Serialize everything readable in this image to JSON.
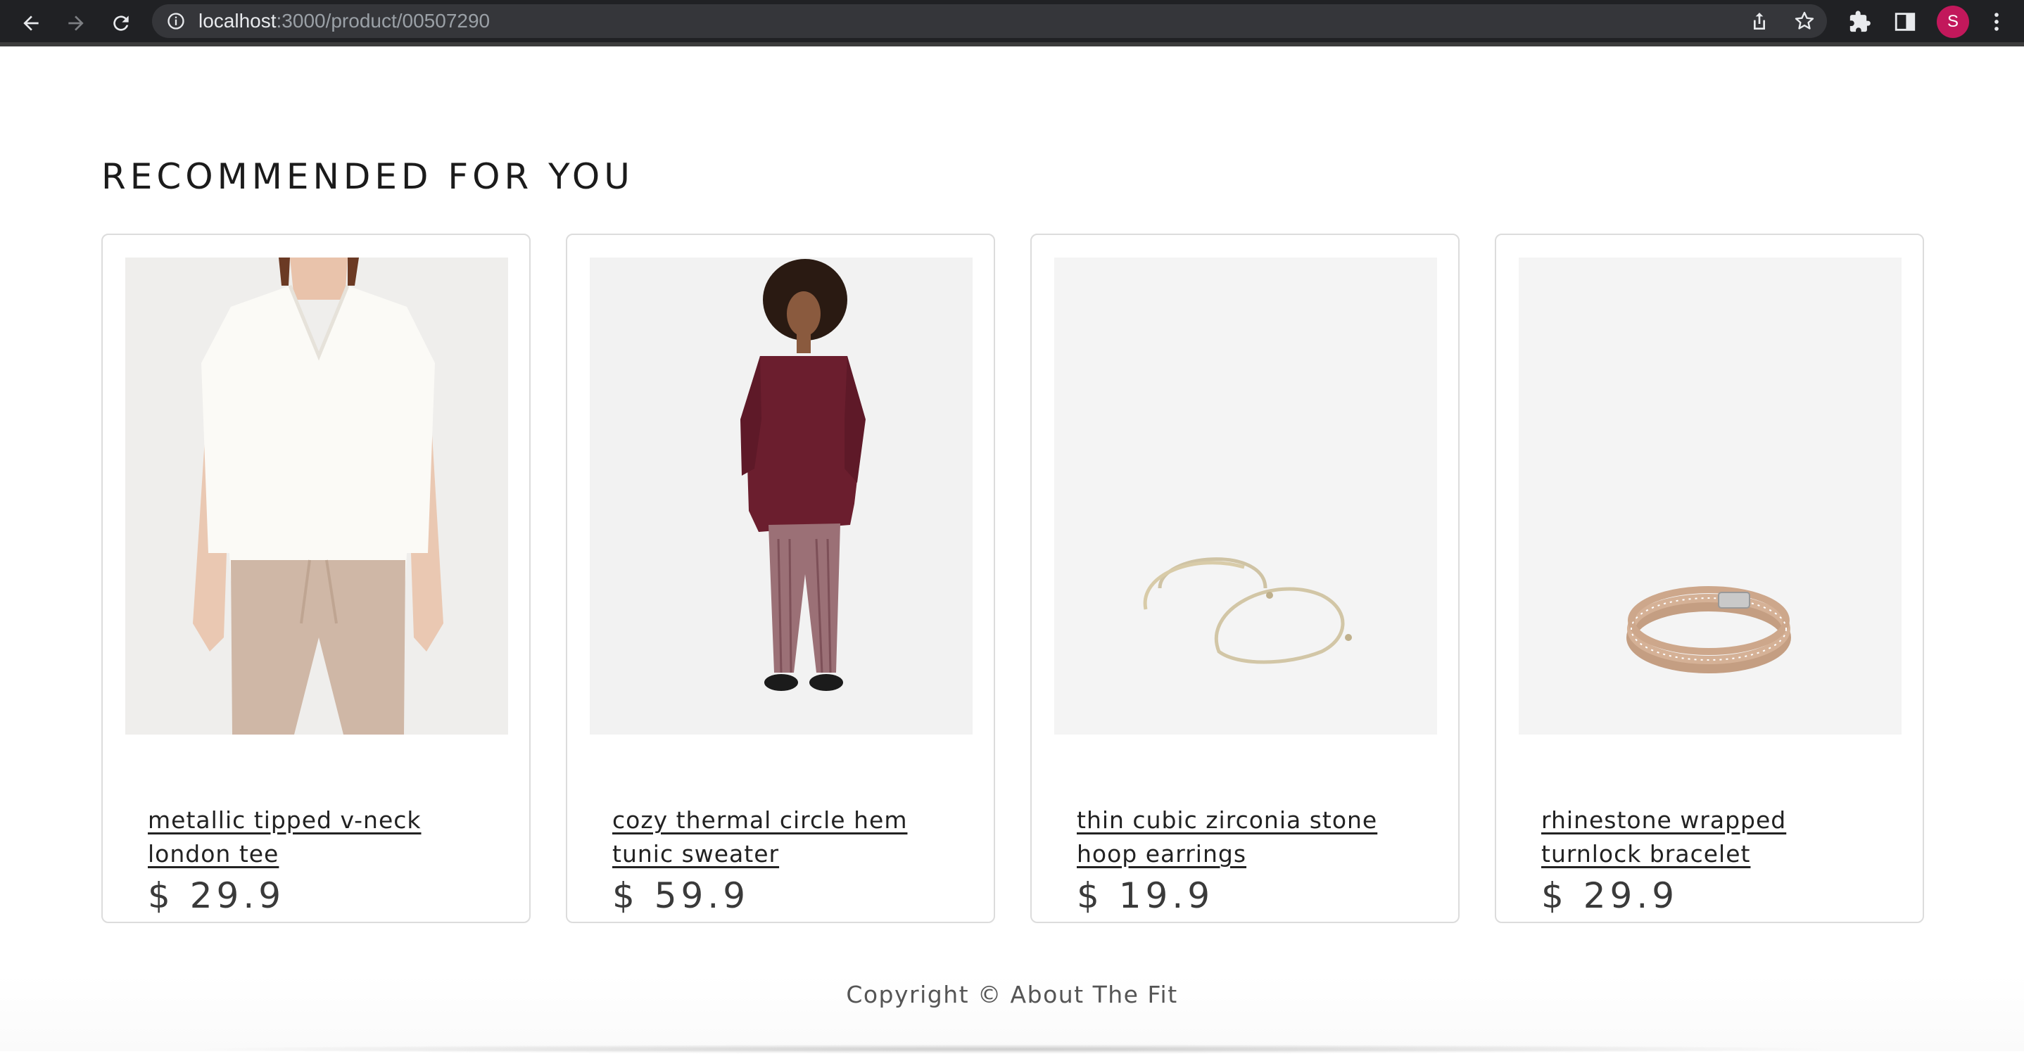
{
  "browser": {
    "url_host": "localhost",
    "url_path": ":3000/product/00507290",
    "profile_initial": "S",
    "profile_color": "#c2185b"
  },
  "section": {
    "title": "RECOMMENDED FOR YOU"
  },
  "products": [
    {
      "name": "metallic tipped v-neck london tee",
      "price": "$ 29.9",
      "image": "woman-white-tee-photo"
    },
    {
      "name": "cozy thermal circle hem tunic sweater",
      "price": "$ 59.9",
      "image": "woman-burgundy-sweater-photo"
    },
    {
      "name": "thin cubic zirconia stone hoop earrings",
      "price": "$ 19.9",
      "image": "hoop-earrings-photo"
    },
    {
      "name": "rhinestone wrapped turnlock bracelet",
      "price": "$ 29.9",
      "image": "rhinestone-bracelet-photo"
    }
  ],
  "footer": {
    "copyright": "Copyright © About The Fit"
  }
}
